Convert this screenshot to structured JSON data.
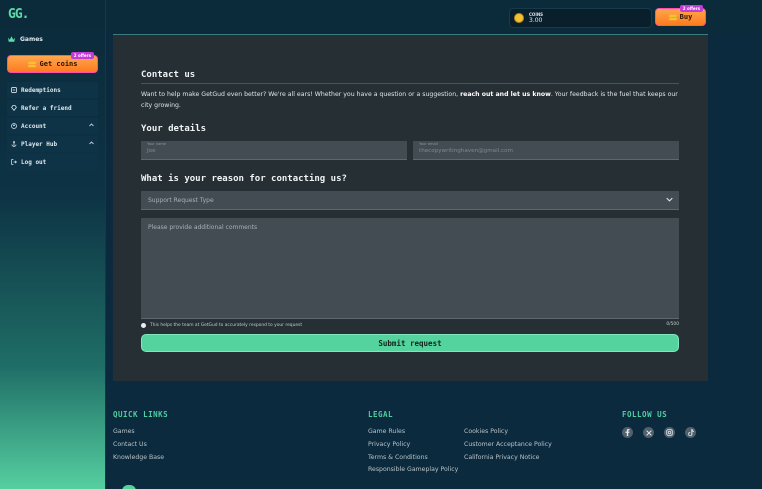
{
  "brand": {
    "logo": "GG",
    "dot": "."
  },
  "sidebar": {
    "games_label": "Games",
    "get_coins_label": "Get coins",
    "get_coins_badge": "2 offers",
    "items": [
      {
        "label": "Redemptions",
        "icon": "redemption-icon"
      },
      {
        "label": "Refer a friend",
        "icon": "diamond-icon"
      },
      {
        "label": "Account",
        "icon": "user-icon",
        "expandable": true
      },
      {
        "label": "Player Hub",
        "icon": "anchor-icon",
        "expandable": true
      },
      {
        "label": "Log out",
        "icon": "logout-icon"
      }
    ]
  },
  "header": {
    "coins_label": "COINS",
    "coins_value": "3.00",
    "buy_label": "Buy",
    "buy_badge": "2 offers"
  },
  "form": {
    "title": "Contact us",
    "intro_pre": "Want to help make GetGud even better? We're all ears! Whether you have a question or a suggestion, ",
    "intro_bold": "reach out and let us know",
    "intro_post": ". Your feedback is the fuel that keeps our city growing.",
    "details_title": "Your details",
    "name_label": "Your name",
    "name_value": "Joe",
    "email_label": "Your email",
    "email_value": "thecopywritinghaven@gmail.com",
    "reason_title": "What is your reason for contacting us?",
    "reason_placeholder": "Support Request Type",
    "comments_placeholder": "Please provide additional comments",
    "help_text": "This helps the team at GetGud to accurately respond to your request",
    "counter": "0/500",
    "submit_label": "Submit request"
  },
  "footer": {
    "quick_links_title": "QUICK LINKS",
    "quick_links": [
      "Games",
      "Contact Us",
      "Knowledge Base"
    ],
    "legal_title": "LEGAL",
    "legal_col1": [
      "Game Rules",
      "Privacy Policy",
      "Terms & Conditions",
      "Responsible Gameplay Policy"
    ],
    "legal_col2": [
      "Cookies Policy",
      "Customer Acceptance Policy",
      "California Privacy Notice"
    ],
    "follow_title": "FOLLOW US",
    "socials": [
      "facebook-icon",
      "x-icon",
      "instagram-icon",
      "tiktok-icon"
    ]
  },
  "colors": {
    "accent": "#55d39f",
    "orange": "#ff8a2a",
    "badge": "#c13dd6",
    "panel": "#262f34"
  }
}
